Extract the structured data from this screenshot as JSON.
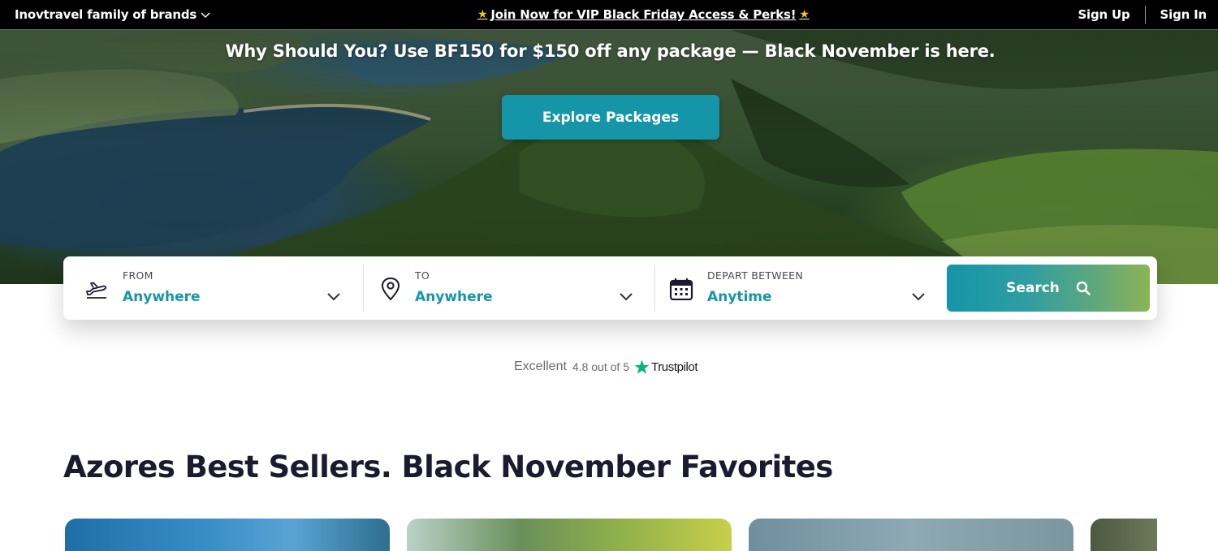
{
  "topbar": {
    "brands_label": "Inovtravel family of brands",
    "promo_text": "Join Now for VIP Black Friday Access & Perks!",
    "promo_star": "★",
    "signup": "Sign Up",
    "signin": "Sign In"
  },
  "hero": {
    "headline": "Why Should You? Use BF150 for $150 off any package — Black November is here.",
    "cta": "Explore Packages"
  },
  "search": {
    "from": {
      "label": "FROM",
      "value": "Anywhere",
      "icon": "airplane-departure-icon"
    },
    "to": {
      "label": "TO",
      "value": "Anywhere",
      "icon": "map-pin-icon"
    },
    "depart": {
      "label": "DEPART BETWEEN",
      "value": "Anytime",
      "icon": "calendar-icon"
    },
    "button": "Search"
  },
  "trustpilot": {
    "word": "Excellent",
    "rating": "4.8 out of 5",
    "brand": "Trustpilot",
    "star_color": "#00b67a"
  },
  "section": {
    "title": "Azores Best Sellers. Black November Favorites"
  },
  "colors": {
    "accent": "#1596a8",
    "topbar_bg": "#000000",
    "search_gradient_end": "#8cb454"
  }
}
